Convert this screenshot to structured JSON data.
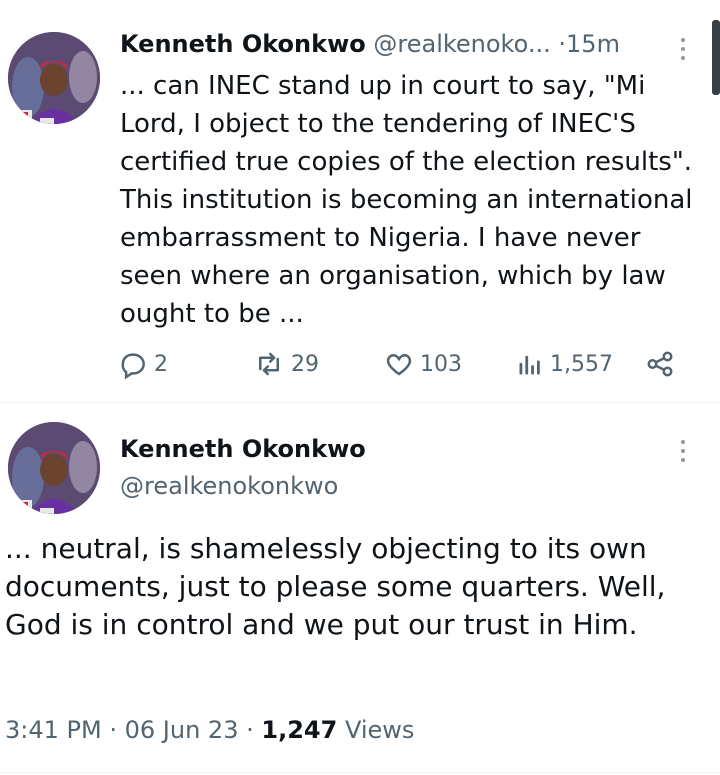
{
  "tweet1": {
    "author_name": "Kenneth Okonkwo",
    "handle": "@realkenoko...",
    "separator": "·",
    "time": "15m",
    "text": "... can INEC stand up in court to say, \"Mi Lord, I object to the tendering of INEC'S certified true copies of the election results\". This institution is becoming an international embarrassment to Nigeria. I have never seen where an organisation, which by law ought to be ...",
    "actions": {
      "replies": "2",
      "reposts": "29",
      "likes": "103",
      "views": "1,557"
    }
  },
  "tweet2": {
    "author_name": "Kenneth Okonkwo",
    "handle": "@realkenokonkwo",
    "text": "... neutral, is shamelessly objecting to its own documents, just to please some quarters. Well, God is in control and we put our trust in Him.",
    "time": "3:41 PM",
    "date": "06 Jun 23",
    "separator": "·",
    "views_count": "1,247",
    "views_label": "Views"
  },
  "colors": {
    "text": "#0f1419",
    "muted": "#536471",
    "divider": "#eff3f4"
  },
  "icons": [
    "reply-icon",
    "repost-icon",
    "like-icon",
    "views-icon",
    "share-icon",
    "more-icon"
  ]
}
